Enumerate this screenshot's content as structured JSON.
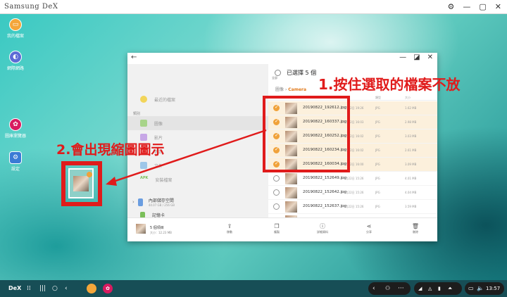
{
  "window": {
    "title": "Samsung DeX"
  },
  "desktop": {
    "icons": [
      {
        "label": "我的檔案",
        "color": "#f4a63a",
        "glyph": "▭"
      },
      {
        "label": "網際網路",
        "color": "#5c6bd6",
        "glyph": "◐"
      },
      {
        "label": "圖庫瀏覽器",
        "color": "#d81b60",
        "glyph": "✿"
      },
      {
        "label": "設定",
        "color": "#3a7bd5",
        "glyph": "⚙"
      }
    ]
  },
  "files": {
    "selection_label": "已選擇 5 個",
    "select_all_label": "全部",
    "breadcrumb": {
      "parent": "圖像",
      "separator": "›",
      "current": "Camera"
    },
    "columns": {
      "type": "類型",
      "size": "大小"
    },
    "sidebar": {
      "recent": "最近的檔案",
      "category_header": "類別",
      "items": [
        "圖像",
        "影片",
        "音訊",
        "文件",
        "安裝檔案"
      ],
      "apk_tag": "APK",
      "storage": {
        "name": "內部儲存空間",
        "detail": "44.07 GB / 256 GB"
      },
      "sdcard": "記憶卡"
    },
    "rows": [
      {
        "name": "20190822_192612.jpg",
        "date": "8月22日 19:26",
        "type": "JPG",
        "size": "1.62 MB",
        "selected": true
      },
      {
        "name": "20190822_160337.jpg",
        "date": "8月22日 16:03",
        "type": "JPG",
        "size": "2.98 MB",
        "selected": true
      },
      {
        "name": "20190822_160252.jpg",
        "date": "8月22日 16:02",
        "type": "JPG",
        "size": "3.03 MB",
        "selected": true
      },
      {
        "name": "20190822_160234.jpg",
        "date": "8月22日 16:02",
        "type": "JPG",
        "size": "2.61 MB",
        "selected": true
      },
      {
        "name": "20190822_160034.jpg",
        "date": "8月22日 16:00",
        "type": "JPG",
        "size": "3.09 MB",
        "selected": true
      },
      {
        "name": "20190822_152649.jpg",
        "date": "8月22日 15:26",
        "type": "JPG",
        "size": "4.01 MB",
        "selected": false
      },
      {
        "name": "20190822_152642.jpg",
        "date": "8月22日 15:26",
        "type": "JPG",
        "size": "4.04 MB",
        "selected": false
      },
      {
        "name": "20190822_152637.jpg",
        "date": "8月22日 15:26",
        "type": "JPG",
        "size": "3.59 MB",
        "selected": false
      },
      {
        "name": "20190822_152616.jpg",
        "date": "8月22日 15:26",
        "type": "JPG",
        "size": "3.59 MB",
        "selected": false
      }
    ],
    "bottom": {
      "count": "5 個項目",
      "size": "大小：12.23 MB",
      "actions": [
        {
          "label": "移動",
          "glyph": "⇪"
        },
        {
          "label": "複製",
          "glyph": "❐"
        },
        {
          "label": "詳細資料",
          "glyph": "ⓘ"
        },
        {
          "label": "分享",
          "glyph": "⋖"
        },
        {
          "label": "刪除",
          "glyph": "🗑"
        }
      ]
    }
  },
  "annotations": {
    "step1": "1.按住選取的檔案不放",
    "step2": "2.會出現縮圖圖示"
  },
  "taskbar": {
    "dex": "DeX",
    "time": "13:57"
  },
  "colors": {
    "accent": "#f0a23a",
    "annotation": "#e01b1b",
    "breadcrumb_current": "#e17a1c"
  }
}
